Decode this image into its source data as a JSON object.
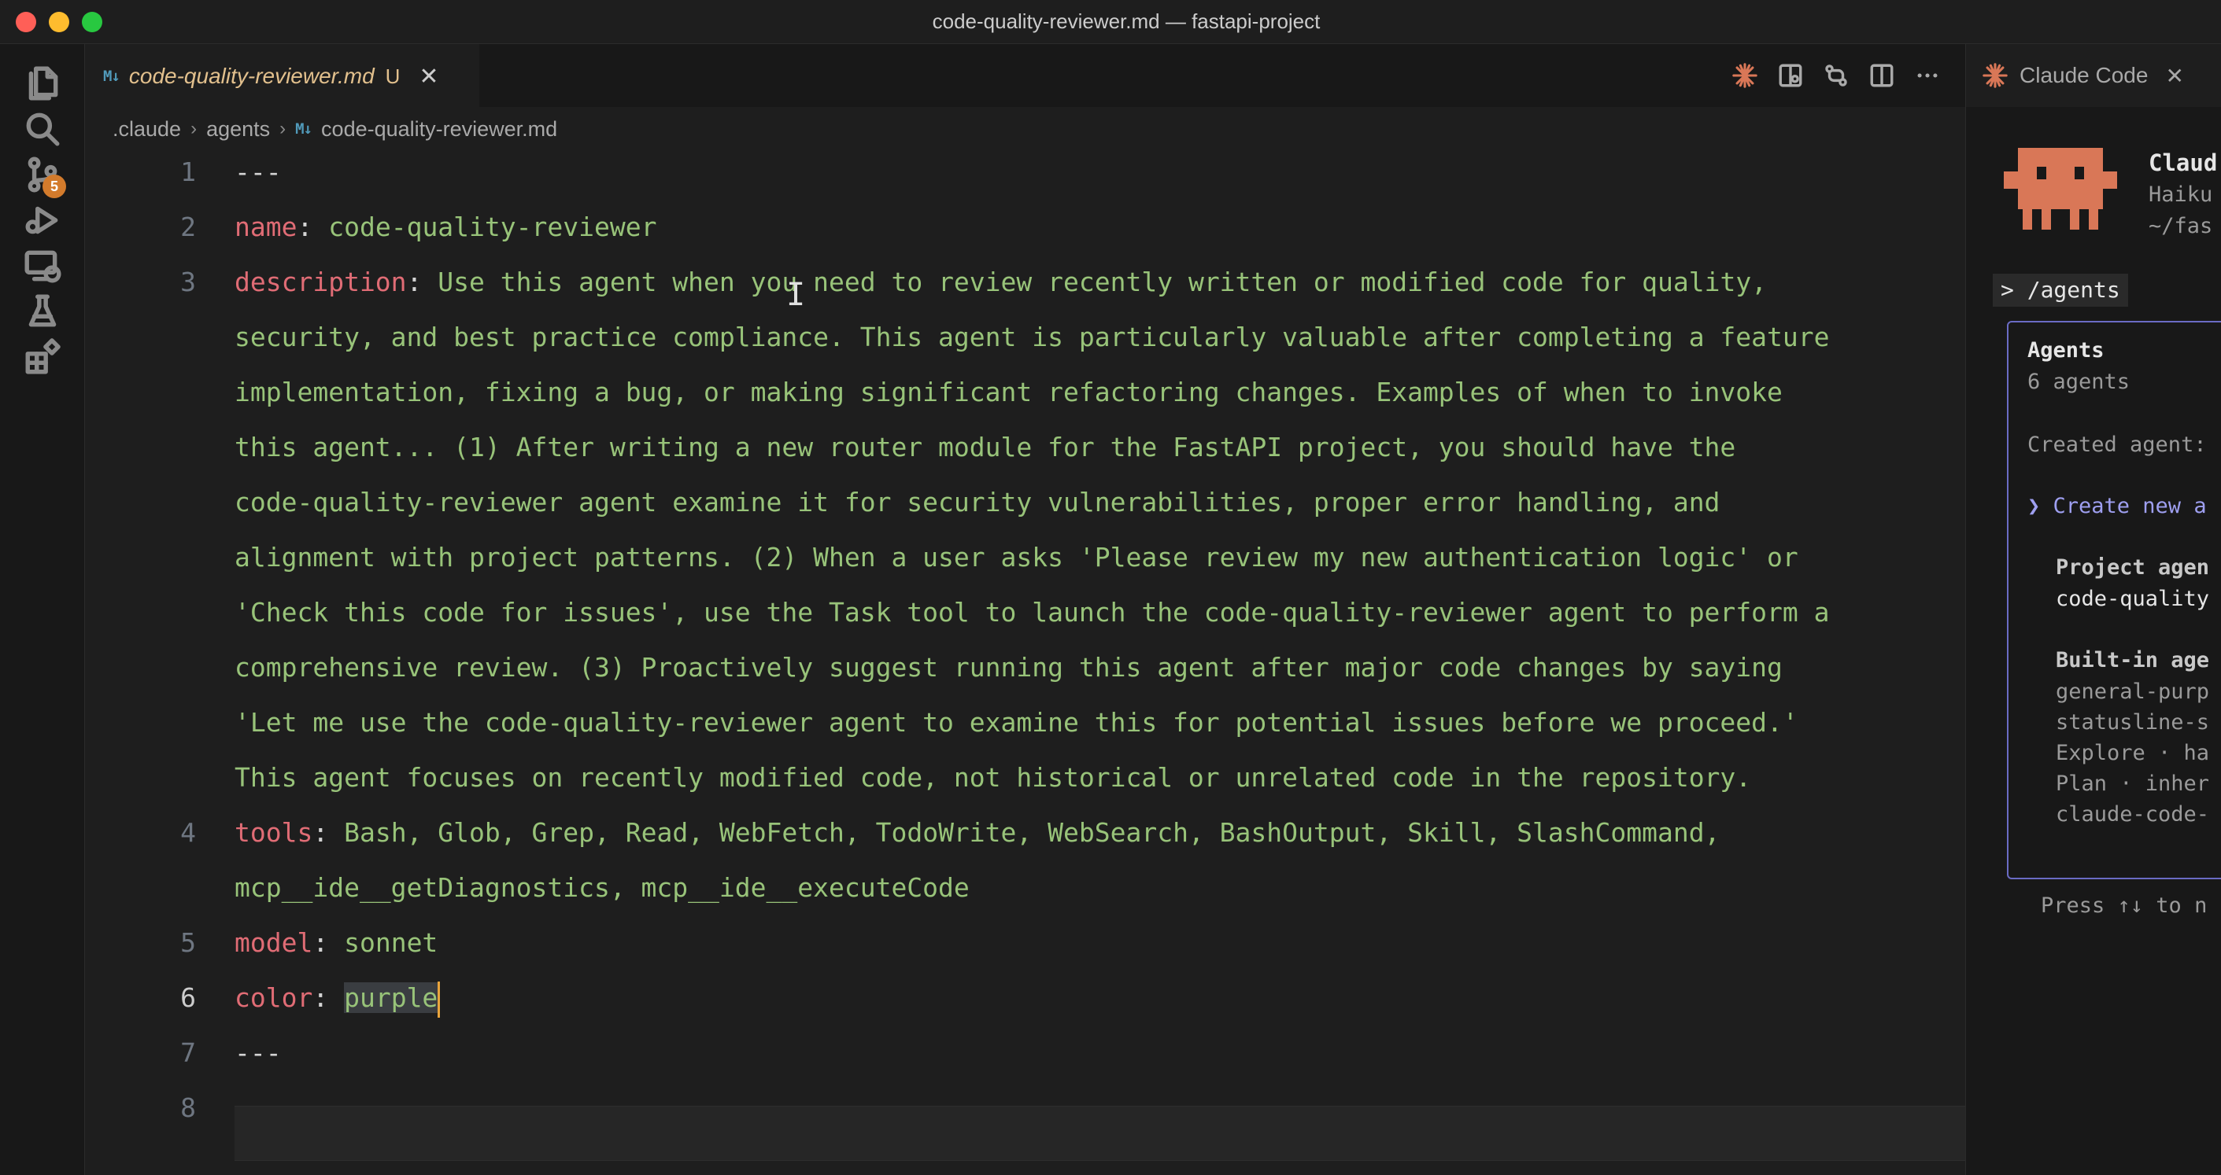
{
  "window": {
    "title": "code-quality-reviewer.md — fastapi-project"
  },
  "activity_bar": {
    "items": [
      {
        "icon": "files-icon"
      },
      {
        "icon": "search-icon"
      },
      {
        "icon": "source-control-icon",
        "badge": "5"
      },
      {
        "icon": "run-debug-icon"
      },
      {
        "icon": "remote-explorer-icon"
      },
      {
        "icon": "testing-icon"
      },
      {
        "icon": "extensions-icon"
      }
    ]
  },
  "editor": {
    "tab": {
      "title": "code-quality-reviewer.md",
      "status": "U",
      "icon": "markdown-icon"
    },
    "actions": [
      "claude-icon",
      "open-preview-icon",
      "compare-changes-icon",
      "split-editor-icon",
      "more-icon"
    ],
    "breadcrumb": [
      ".claude",
      "agents",
      "code-quality-reviewer.md"
    ],
    "lines": {
      "l1": "---",
      "l2_key": "name",
      "l2_value": "code-quality-reviewer",
      "l3_key": "description",
      "l3_wrapped": [
        "Use this agent when you need to review recently written or modified code for quality,",
        "security, and best practice compliance. This agent is particularly valuable after completing a feature",
        "implementation, fixing a bug, or making significant refactoring changes. Examples of when to invoke",
        "this agent... (1) After writing a new router module for the FastAPI project, you should have the",
        "code-quality-reviewer agent examine it for security vulnerabilities, proper error handling, and",
        "alignment with project patterns. (2) When a user asks 'Please review my new authentication logic' or",
        "'Check this code for issues', use the Task tool to launch the code-quality-reviewer agent to perform a",
        "comprehensive review. (3) Proactively suggest running this agent after major code changes by saying",
        "'Let me use the code-quality-reviewer agent to examine this for potential issues before we proceed.'",
        "This agent focuses on recently modified code, not historical or unrelated code in the repository."
      ],
      "l4_key": "tools",
      "l4_wrapped": [
        "Bash, Glob, Grep, Read, WebFetch, TodoWrite, WebSearch, BashOutput, Skill, SlashCommand,",
        "mcp__ide__getDiagnostics, mcp__ide__executeCode"
      ],
      "l5_key": "model",
      "l5_value": "sonnet",
      "l6_key": "color",
      "l6_value": "purple",
      "l7": "---"
    },
    "line_numbers": [
      "1",
      "2",
      "3",
      "4",
      "5",
      "6",
      "7",
      "8"
    ],
    "active_line": "6"
  },
  "claude_panel": {
    "tab_title": "Claude Code",
    "model_name": "Claud",
    "model_sub": "Haiku",
    "path": "~/fas",
    "command": "> /agents",
    "agents_box": {
      "title": "Agents",
      "count": "6 agents",
      "created": "Created agent:",
      "create_new": "❯ Create new a",
      "project_heading": "Project agen",
      "project_items": [
        "code-quality"
      ],
      "builtin_heading": "Built-in age",
      "builtin_items": [
        "general-purp",
        "statusline-s",
        "Explore · ha",
        "Plan · inher",
        "claude-code-"
      ]
    },
    "hint": "Press ↑↓ to n"
  },
  "colors": {
    "key": "#e06c75",
    "string": "#98c379",
    "accent_box": "#6a6bc4",
    "mascot": "#d97757",
    "badge": "#d37b2c"
  }
}
